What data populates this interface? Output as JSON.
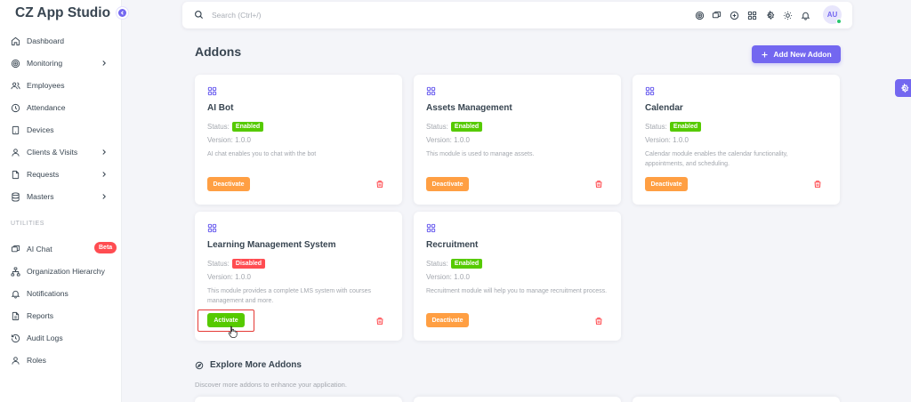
{
  "app": {
    "title": "CZ App Studio"
  },
  "sidebar": {
    "items": [
      {
        "label": "Dashboard",
        "icon": "home-icon"
      },
      {
        "label": "Monitoring",
        "icon": "target-icon"
      },
      {
        "label": "Employees",
        "icon": "users-icon"
      },
      {
        "label": "Attendance",
        "icon": "clock-icon"
      },
      {
        "label": "Devices",
        "icon": "devices-icon"
      },
      {
        "label": "Clients & Visits",
        "icon": "user-icon"
      },
      {
        "label": "Requests",
        "icon": "file-icon"
      },
      {
        "label": "Masters",
        "icon": "database-icon"
      }
    ],
    "section_title": "UTILITIES",
    "utilities": [
      {
        "label": "AI Chat",
        "icon": "chat-icon",
        "badge": "Beta"
      },
      {
        "label": "Organization Hierarchy",
        "icon": "hierarchy-icon"
      },
      {
        "label": "Notifications",
        "icon": "bell-icon"
      },
      {
        "label": "Reports",
        "icon": "report-icon"
      },
      {
        "label": "Audit Logs",
        "icon": "history-icon"
      },
      {
        "label": "Roles",
        "icon": "user-icon"
      }
    ]
  },
  "topbar": {
    "search_placeholder": "Search (Ctrl+/)",
    "icons": [
      "target-icon",
      "chat-icon",
      "plus-circle-icon",
      "apps-grid-icon",
      "settings-icon",
      "sun-icon",
      "bell-icon"
    ],
    "avatar_initials": "AU"
  },
  "page": {
    "title": "Addons",
    "add_button": "Add New Addon"
  },
  "labels": {
    "status": "Status:",
    "version_prefix": "Version: "
  },
  "addons": [
    {
      "title": "AI Bot",
      "status": "Enabled",
      "version": "1.0.0",
      "description": "AI chat enables you to chat with the bot",
      "action": "Deactivate"
    },
    {
      "title": "Assets Management",
      "status": "Enabled",
      "version": "1.0.0",
      "description": "This module is used to manage assets.",
      "action": "Deactivate"
    },
    {
      "title": "Calendar",
      "status": "Enabled",
      "version": "1.0.0",
      "description": "Calendar module enables the calendar functionality, appointments, and scheduling.",
      "action": "Deactivate"
    },
    {
      "title": "Learning Management System",
      "status": "Disabled",
      "version": "1.0.0",
      "description": "This module provides a complete LMS system with courses management and more.",
      "action": "Activate"
    },
    {
      "title": "Recruitment",
      "status": "Enabled",
      "version": "1.0.0",
      "description": "Recruitment module will help you to manage recruitment process.",
      "action": "Deactivate"
    }
  ],
  "explore": {
    "title": "Explore More Addons",
    "subtitle": "Discover more addons to enhance your application."
  },
  "colors": {
    "primary": "#7367f0",
    "enabled": "#56ca00",
    "disabled": "#ff4c51",
    "warning": "#ff9f43"
  }
}
